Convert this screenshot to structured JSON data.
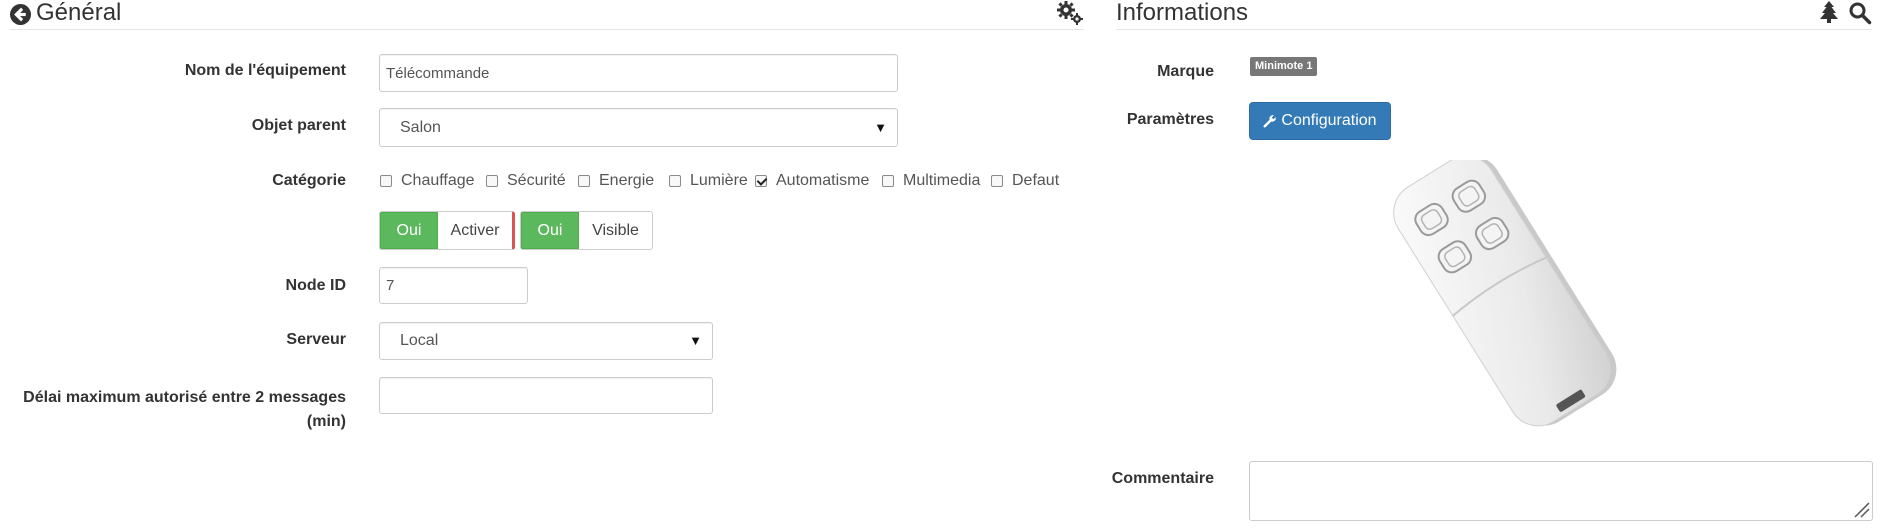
{
  "general": {
    "title": "Général",
    "icons": {
      "back": "circle-arrow-left-icon",
      "settings": "gears-icon"
    },
    "fields": {
      "name": {
        "label": "Nom de l'équipement",
        "value": "Télécommande"
      },
      "parent": {
        "label": "Objet parent",
        "value": "Salon"
      },
      "category": {
        "label": "Catégorie",
        "items": [
          {
            "label": "Chauffage",
            "checked": false
          },
          {
            "label": "Sécurité",
            "checked": false
          },
          {
            "label": "Energie",
            "checked": false
          },
          {
            "label": "Lumière",
            "checked": false
          },
          {
            "label": "Automatisme",
            "checked": true
          },
          {
            "label": "Multimedia",
            "checked": false
          },
          {
            "label": "Defaut",
            "checked": false
          }
        ]
      },
      "toggles": [
        {
          "on_label": "Oui",
          "label": "Activer"
        },
        {
          "on_label": "Oui",
          "label": "Visible"
        }
      ],
      "node_id": {
        "label": "Node ID",
        "value": "7"
      },
      "server": {
        "label": "Serveur",
        "value": "Local"
      },
      "delay": {
        "label_line1": "Délai maximum autorisé entre 2 messages",
        "label_line2": "(min)",
        "value": ""
      }
    }
  },
  "info": {
    "title": "Informations",
    "icons": {
      "tree": "tree-icon",
      "search": "search-icon"
    },
    "brand": {
      "label": "Marque",
      "badge": "Minimote 1"
    },
    "params": {
      "label": "Paramètres",
      "button": "Configuration",
      "button_icon": "wrench-icon"
    },
    "comment": {
      "label": "Commentaire",
      "value": ""
    }
  },
  "colors": {
    "primary": "#337ab7",
    "success": "#5cb85c",
    "badge": "#777777",
    "toggle_divider": "#d9534f"
  }
}
